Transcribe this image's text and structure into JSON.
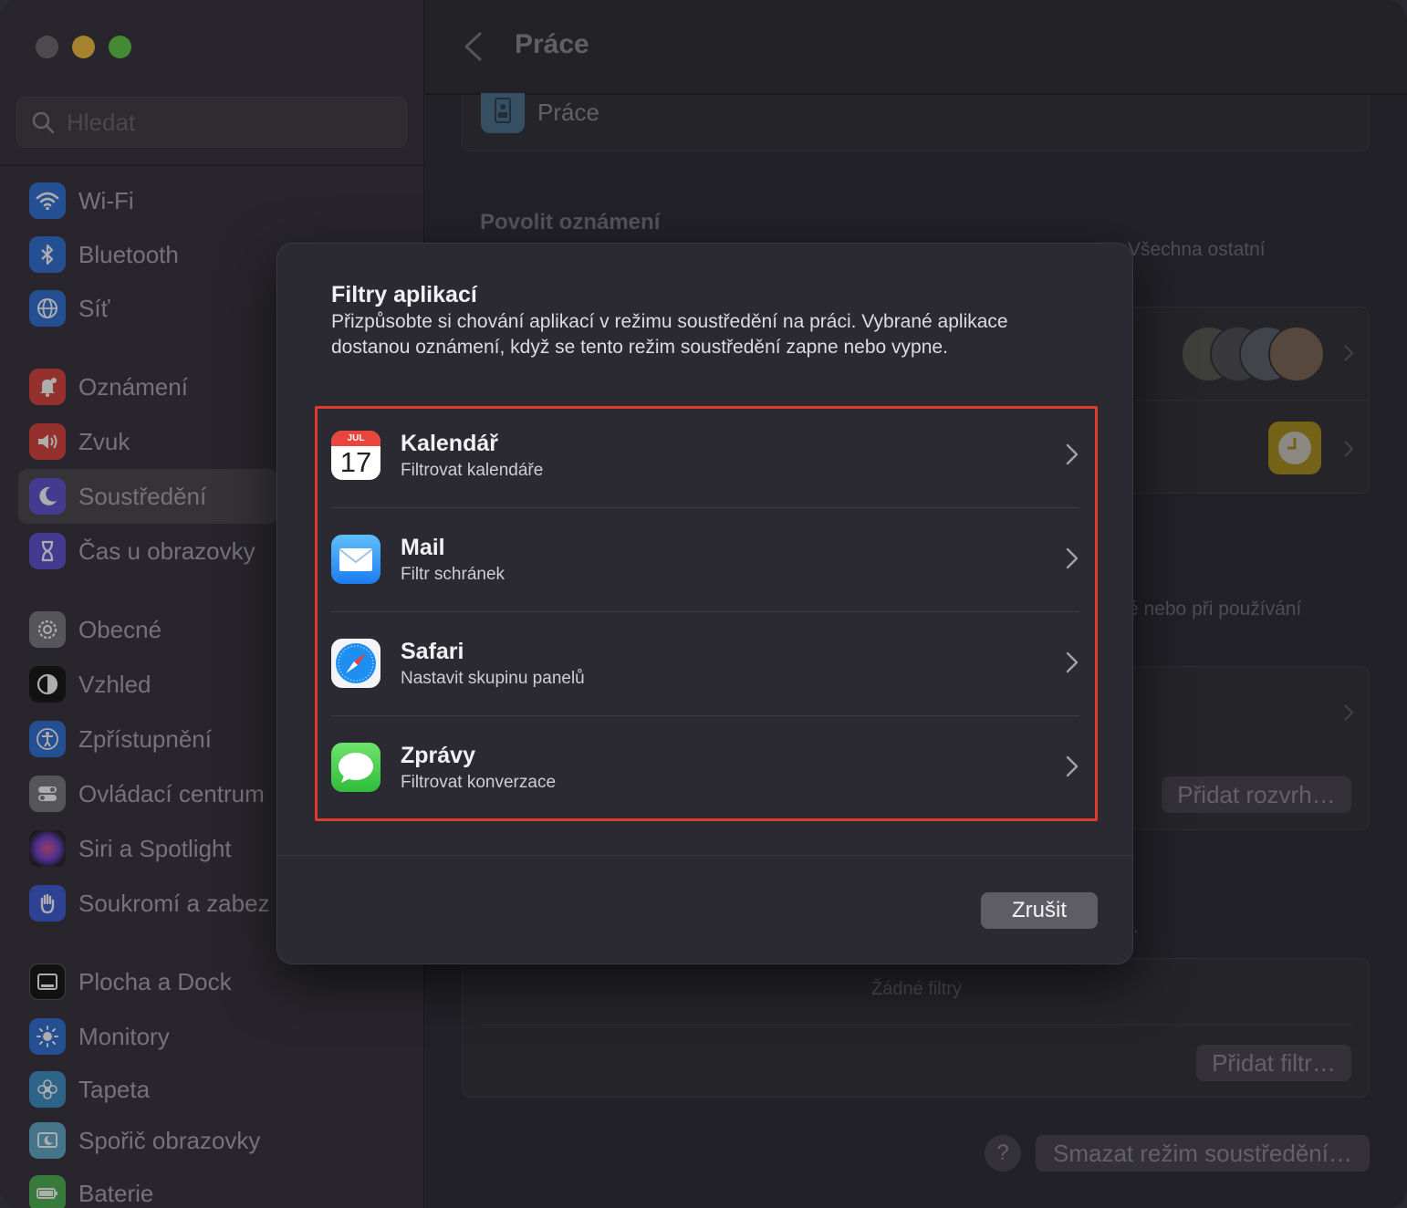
{
  "search": {
    "placeholder": "Hledat"
  },
  "sidebar": {
    "items": [
      {
        "label": "Wi-Fi",
        "icon": "wifi-icon",
        "color": "#2f6fd6"
      },
      {
        "label": "Bluetooth",
        "icon": "bluetooth-icon",
        "color": "#2f6fd6"
      },
      {
        "label": "Síť",
        "icon": "globe-icon",
        "color": "#2f6fd6"
      },
      {
        "label": "Oznámení",
        "icon": "bell-icon",
        "color": "#d9413a"
      },
      {
        "label": "Zvuk",
        "icon": "speaker-icon",
        "color": "#d9413a"
      },
      {
        "label": "Soustředění",
        "icon": "moon-icon",
        "color": "#5e4fd0"
      },
      {
        "label": "Čas u obrazovky",
        "icon": "hourglass-icon",
        "color": "#5e4fd0"
      },
      {
        "label": "Obecné",
        "icon": "gear-icon",
        "color": "#7a7a7e"
      },
      {
        "label": "Vzhled",
        "icon": "appearance-icon",
        "color": "#111111"
      },
      {
        "label": "Zpřístupnění",
        "icon": "accessibility-icon",
        "color": "#2f6fd6"
      },
      {
        "label": "Ovládací centrum",
        "icon": "toggles-icon",
        "color": "#7a7a7e"
      },
      {
        "label": "Siri a Spotlight",
        "icon": "siri-icon",
        "color": "#333339"
      },
      {
        "label": "Soukromí a zabez",
        "icon": "hand-icon",
        "color": "#3b5bd6"
      },
      {
        "label": "Plocha a Dock",
        "icon": "dock-icon",
        "color": "#111111"
      },
      {
        "label": "Monitory",
        "icon": "sun-icon",
        "color": "#2f6fd6"
      },
      {
        "label": "Tapeta",
        "icon": "flower-icon",
        "color": "#3d8fc4"
      },
      {
        "label": "Spořič obrazovky",
        "icon": "screensaver-icon",
        "color": "#5fa9c8"
      },
      {
        "label": "Baterie",
        "icon": "battery-icon",
        "color": "#4caf50"
      }
    ]
  },
  "header": {
    "title": "Práce"
  },
  "background": {
    "focus_name": "Práce",
    "section_title": "Povolit oznámení",
    "partial_text_1": "Všechna ostatní",
    "partial_text_2": "é nebo při používání",
    "partial_text_3": "í.",
    "add_schedule": "Přidat rozvrh…",
    "no_filters": "Žádné filtry",
    "add_filter": "Přidat filtr…",
    "help": "?",
    "delete_focus": "Smazat režim soustředění…"
  },
  "dialog": {
    "title": "Filtry aplikací",
    "description": "Přizpůsobte si chování aplikací v režimu soustředění na práci. Vybrané aplikace dostanou oznámení, když se tento režim soustředění zapne nebo vypne.",
    "apps": [
      {
        "name": "Kalendář",
        "subtitle": "Filtrovat kalendáře",
        "icon": "calendar-icon",
        "month": "JUL",
        "day": "17"
      },
      {
        "name": "Mail",
        "subtitle": "Filtr schránek",
        "icon": "mail-icon"
      },
      {
        "name": "Safari",
        "subtitle": "Nastavit skupinu panelů",
        "icon": "safari-icon"
      },
      {
        "name": "Zprávy",
        "subtitle": "Filtrovat konverzace",
        "icon": "messages-icon"
      }
    ],
    "cancel_label": "Zrušit",
    "highlight_color": "#e03a2e"
  }
}
